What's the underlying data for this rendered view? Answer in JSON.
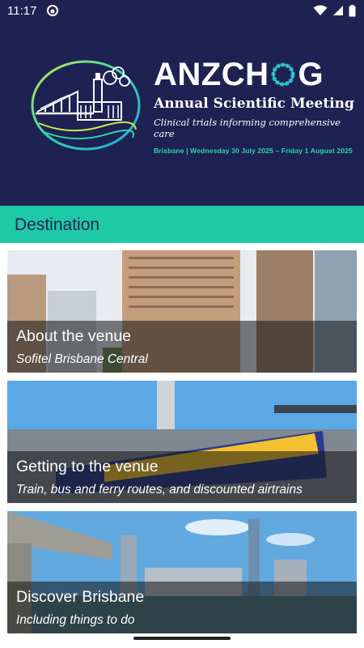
{
  "status_bar": {
    "time": "11:17"
  },
  "hero": {
    "title_part1": "ANZCH",
    "title_part2": "G",
    "subtitle": "Annual Scientific Meeting",
    "tagline": "Clinical trials informing comprehensive care",
    "dates": "Brisbane | Wednesday 30 July 2025 – Friday 1 August 2025"
  },
  "section": {
    "title": "Destination"
  },
  "cards": [
    {
      "title": "About the venue",
      "subtitle": "Sofitel Brisbane Central"
    },
    {
      "title": "Getting to the venue",
      "subtitle": "Train, bus and ferry routes, and discounted airtrains"
    },
    {
      "title": "Discover Brisbane",
      "subtitle": "Including things to do"
    }
  ],
  "colors": {
    "navy": "#1e2253",
    "teal": "#1ec9a6",
    "accent_green": "#2fd3b0"
  }
}
